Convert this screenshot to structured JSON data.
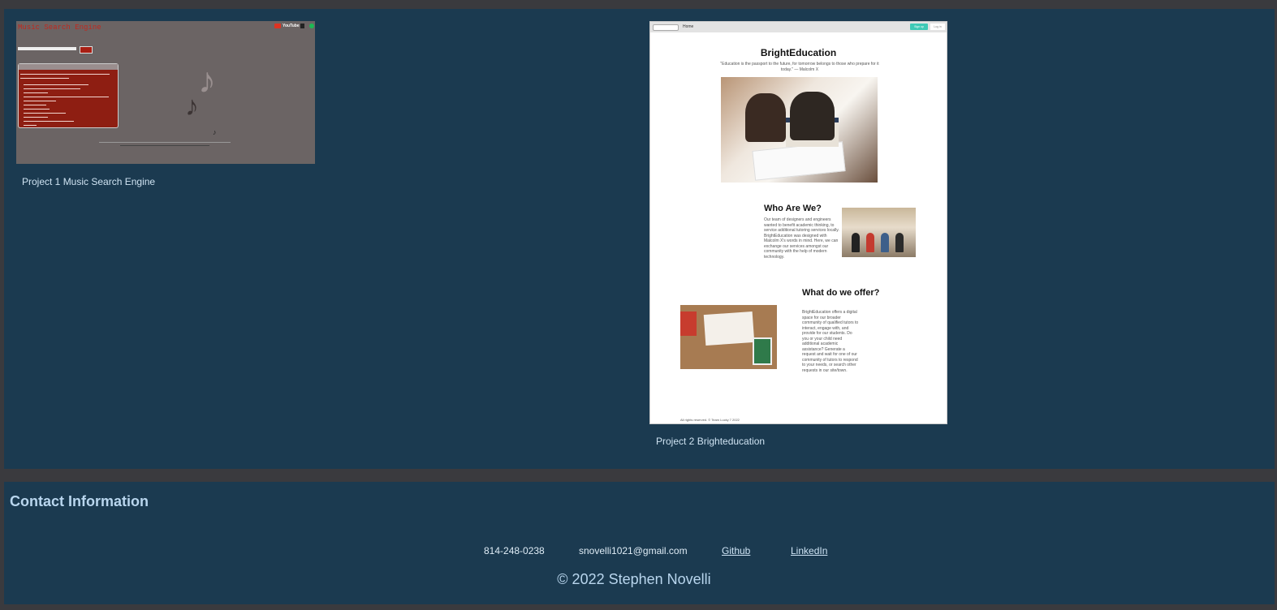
{
  "projects": [
    {
      "title": "Project 1 Music Search Engine",
      "thumbnail": {
        "app_title": "Music Search Engine",
        "brand_label": "YouTube"
      }
    },
    {
      "title": "Project 2 Brighteducation",
      "thumbnail": {
        "nav_home": "Home",
        "nav_signup": "Sign up",
        "nav_login": "Log in",
        "app_title": "BrightEducation",
        "quote": "\"Education is the passport to the future, for tomorrow belongs to those who prepare for it today.\" — Malcolm X",
        "section1_heading": "Who Are We?",
        "section1_text": "Our team of designers and engineers wanted to benefit academic thinking, to service additional tutoring services locally. BrightEducation was designed with Malcolm X's words in mind. Here, we can exchange our services amongst our community with the help of modern technology.",
        "section2_heading": "What do we offer?",
        "section2_text": "BrightEducation offers a digital space for our broader community of qualified tutors to interact, engage with, and provide for our students. Do you or your child need additional academic assistance? Generate a request and wait for one of our community of tutors to respond to your needs, or search other requests in our site/town.",
        "footer": "All rights reserved. © Team Lucky 7 2022"
      }
    }
  ],
  "contact": {
    "heading": "Contact Information",
    "phone": "814-248-0238",
    "email": "snovelli1021@gmail.com",
    "github": "Github",
    "linkedin": "LinkedIn",
    "copyright": "© 2022 Stephen Novelli"
  },
  "colors": {
    "page_border": "#3a3a3e",
    "panel_bg": "#1b3a50",
    "heading_text": "#b9d6ee"
  }
}
